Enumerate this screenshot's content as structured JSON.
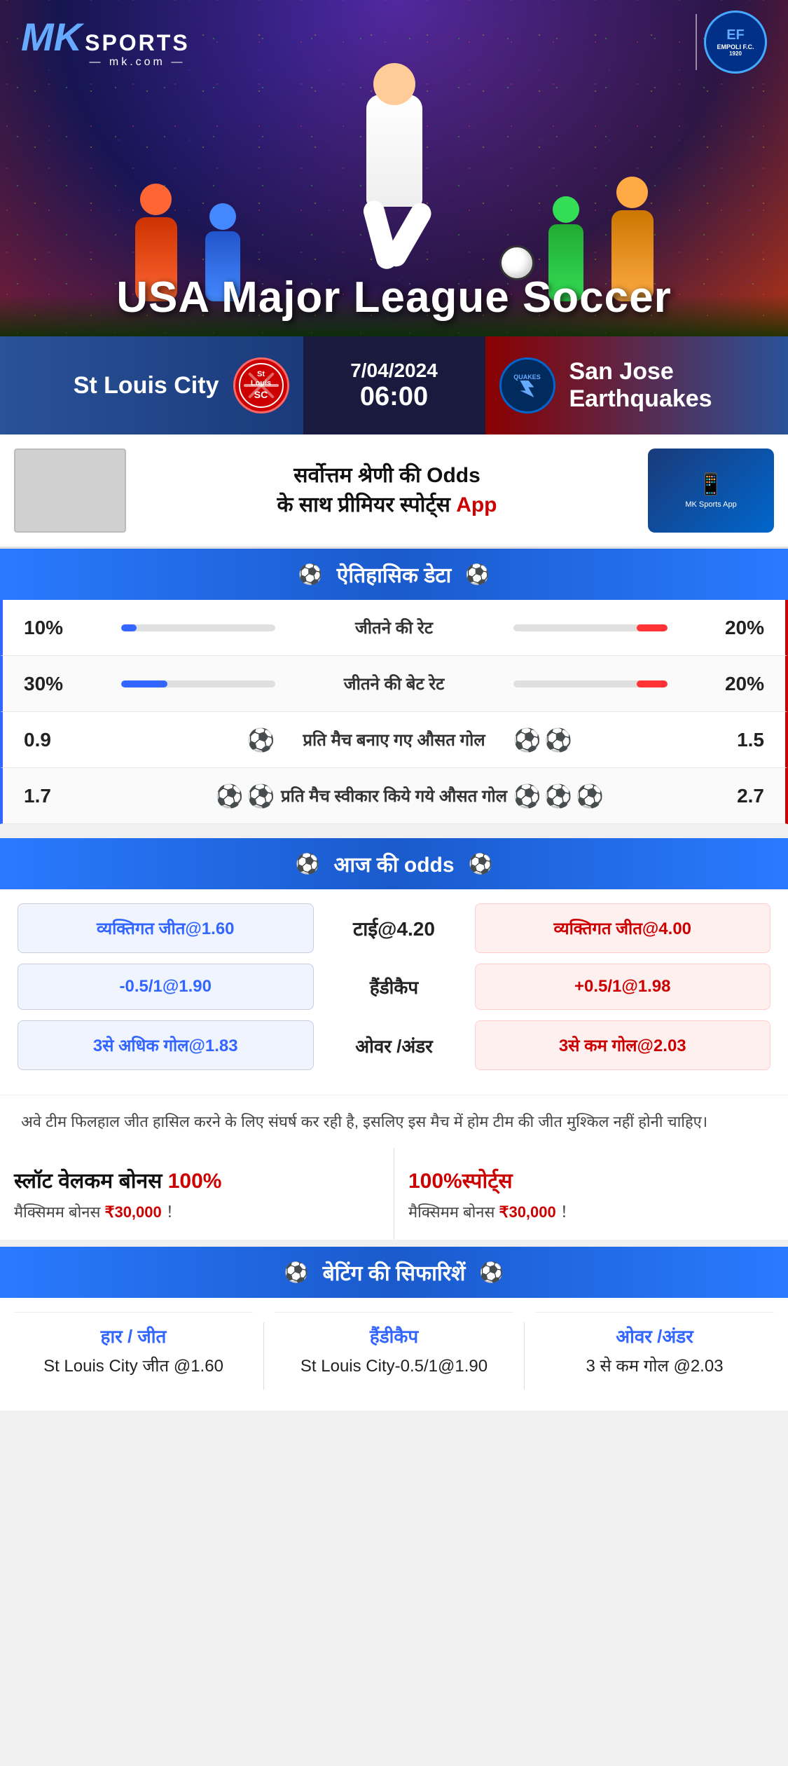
{
  "brand": {
    "name": "MK",
    "sports": "SPORTS",
    "domain": "mk.com",
    "partner": "EMPOLI F.C."
  },
  "hero": {
    "title": "USA Major League Soccer"
  },
  "match": {
    "date": "7/04/2024",
    "time": "06:00",
    "team_home": "St Louis City",
    "team_away": "San Jose Earthquakes",
    "team_away_short": "QUAKES",
    "league": "USA Major League Soccer"
  },
  "promo": {
    "text": "सर्वोत्तम श्रेणी की Odds के साथ प्रीमियर स्पोर्ट्स App",
    "text_bold": "Odds",
    "text_app": "App"
  },
  "historical": {
    "section_title": "ऐतिहासिक डेटा",
    "stats": [
      {
        "label": "जीतने की रेट",
        "left_val": "10%",
        "right_val": "20%",
        "left_pct": 10,
        "right_pct": 20,
        "type": "bar"
      },
      {
        "label": "जीतने की बेट रेट",
        "left_val": "30%",
        "right_val": "20%",
        "left_pct": 30,
        "right_pct": 20,
        "type": "bar"
      },
      {
        "label": "प्रति मैच बनाए गए औसत गोल",
        "left_val": "0.9",
        "right_val": "1.5",
        "left_balls": 1,
        "right_balls": 2,
        "type": "icon"
      },
      {
        "label": "प्रति मैच स्वीकार किये गये औसत गोल",
        "left_val": "1.7",
        "right_val": "2.7",
        "left_balls": 2,
        "right_balls": 3,
        "type": "icon"
      }
    ]
  },
  "odds": {
    "section_title": "आज की odds",
    "rows": [
      {
        "left_label": "व्यक्तिगत जीत@1.60",
        "center_label": "टाई@4.20",
        "right_label": "व्यक्तिगत जीत@4.00",
        "right_color": "red"
      },
      {
        "left_label": "-0.5/1@1.90",
        "center_label": "हैंडीकैप",
        "right_label": "+0.5/1@1.98",
        "right_color": "red"
      },
      {
        "left_label": "3से अधिक गोल@1.83",
        "center_label": "ओवर /अंडर",
        "right_label": "3से कम गोल@2.03",
        "right_color": "red"
      }
    ]
  },
  "disclaimer": {
    "text": "अवे टीम फिलहाल जीत हासिल करने के लिए संघर्ष कर रही है, इसलिए इस मैच में होम टीम की जीत मुश्किल नहीं होनी चाहिए।"
  },
  "bonus": {
    "left": {
      "title": "स्लॉट वेलकम बोनस 100%",
      "subtitle": "मैक्सिमम बोनस ₹30,000  ！"
    },
    "right": {
      "title": "100%स्पोर्ट्स",
      "subtitle": "मैक्सिमम बोनस  ₹30,000 ！"
    }
  },
  "recommendations": {
    "section_title": "बेटिंग की सिफारिशें",
    "items": [
      {
        "type": "हार / जीत",
        "detail": "St Louis City जीत @1.60"
      },
      {
        "type": "हैंडीकैप",
        "detail": "St Louis City-0.5/1@1.90"
      },
      {
        "type": "ओवर /अंडर",
        "detail": "3 से कम गोल @2.03"
      }
    ]
  }
}
